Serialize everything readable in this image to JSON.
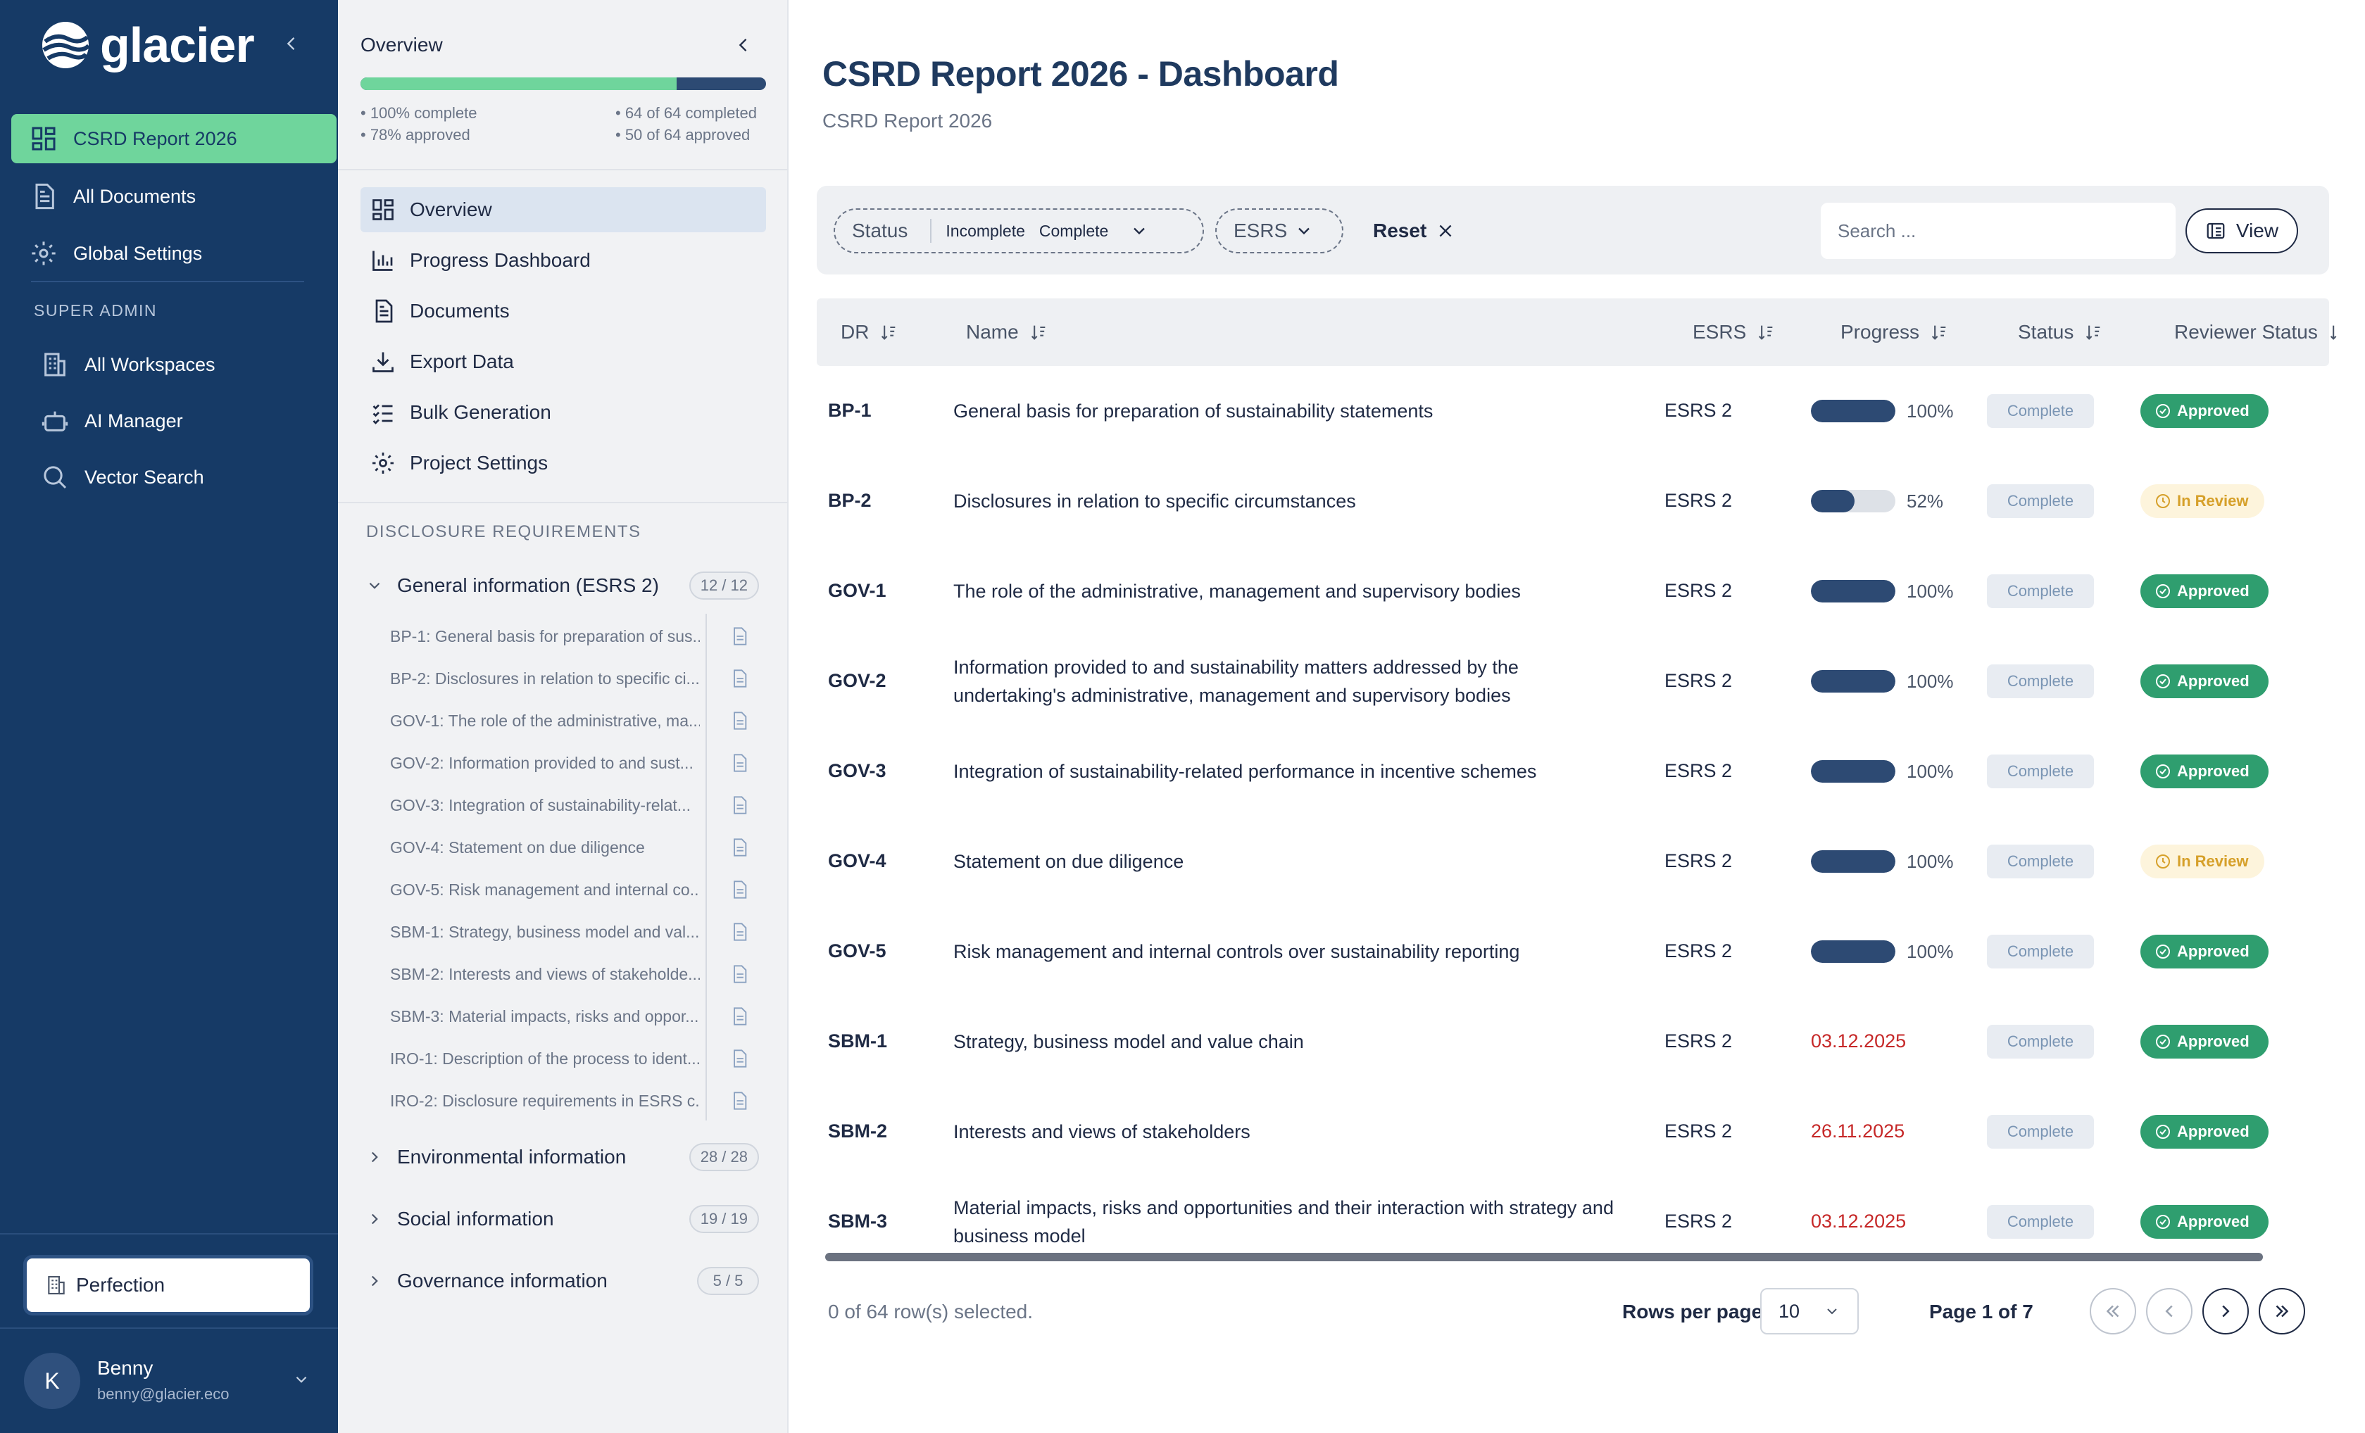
{
  "sidebar": {
    "logo_text": "glacier",
    "nav": [
      {
        "label": "CSRD Report 2026",
        "icon": "dashboard-grid-icon",
        "active": true
      },
      {
        "label": "All Documents",
        "icon": "document-icon"
      },
      {
        "label": "Global Settings",
        "icon": "gear-icon"
      }
    ],
    "section_label": "SUPER ADMIN",
    "admin_nav": [
      {
        "label": "All Workspaces",
        "icon": "building-icon"
      },
      {
        "label": "AI Manager",
        "icon": "robot-icon"
      },
      {
        "label": "Vector Search",
        "icon": "search-icon"
      }
    ],
    "workspace": "Perfection",
    "user": {
      "initial": "K",
      "name": "Benny",
      "email": "benny@glacier.eco"
    }
  },
  "panel": {
    "title": "Overview",
    "progress": {
      "fraction": 0.78,
      "pct_complete": "• 100% complete",
      "pct_approved": "• 78% approved",
      "count_completed": "• 64 of 64 completed",
      "count_approved": "• 50 of 64 approved"
    },
    "menu": [
      {
        "label": "Overview",
        "icon": "dashboard-grid-icon",
        "active": true
      },
      {
        "label": "Progress Dashboard",
        "icon": "bar-chart-icon"
      },
      {
        "label": "Documents",
        "icon": "document-icon"
      },
      {
        "label": "Export Data",
        "icon": "download-icon"
      },
      {
        "label": "Bulk Generation",
        "icon": "checklist-icon"
      },
      {
        "label": "Project Settings",
        "icon": "gear-icon"
      }
    ],
    "section_label": "DISCLOSURE REQUIREMENTS",
    "groups": [
      {
        "label": "General information (ESRS 2)",
        "badge": "12 / 12",
        "expanded": true
      },
      {
        "label": "Environmental information",
        "badge": "28 / 28"
      },
      {
        "label": "Social information",
        "badge": "19 / 19"
      },
      {
        "label": "Governance information",
        "badge": "5 / 5"
      }
    ],
    "docs": [
      "BP-1: General basis for preparation of sus...",
      "BP-2: Disclosures in relation to specific ci...",
      "GOV-1: The role of the administrative, ma...",
      "GOV-2: Information provided to and sust...",
      "GOV-3: Integration of sustainability-relat...",
      "GOV-4: Statement on due diligence",
      "GOV-5: Risk management and internal co...",
      "SBM-1: Strategy, business model and val...",
      "SBM-2: Interests and views of stakeholde...",
      "SBM-3: Material impacts, risks and oppor...",
      "IRO-1: Description of the process to ident...",
      "IRO-2: Disclosure requirements in ESRS c..."
    ]
  },
  "main": {
    "title": "CSRD Report 2026 - Dashboard",
    "subtitle": "CSRD Report 2026",
    "filters": {
      "status_label": "Status",
      "status_chips": [
        "Incomplete",
        "Complete"
      ],
      "esrs_label": "ESRS",
      "reset_label": "Reset",
      "search_placeholder": "Search ...",
      "view_label": "View"
    },
    "columns": [
      "DR",
      "Name",
      "ESRS",
      "Progress",
      "Status",
      "Reviewer Status"
    ],
    "rows": [
      {
        "dr": "BP-1",
        "name": "General basis for preparation of sustainability statements",
        "esrs": "ESRS 2",
        "progress": 100,
        "progress_text": "100%",
        "status": "Complete",
        "review": "Approved"
      },
      {
        "dr": "BP-2",
        "name": "Disclosures in relation to specific circumstances",
        "esrs": "ESRS 2",
        "progress": 52,
        "progress_text": "52%",
        "status": "Complete",
        "review": "In Review"
      },
      {
        "dr": "GOV-1",
        "name": "The role of the administrative, management and supervisory bodies",
        "esrs": "ESRS 2",
        "progress": 100,
        "progress_text": "100%",
        "status": "Complete",
        "review": "Approved"
      },
      {
        "dr": "GOV-2",
        "name": "Information provided to and sustainability matters addressed by the undertaking's administrative, management and supervisory bodies",
        "esrs": "ESRS 2",
        "progress": 100,
        "progress_text": "100%",
        "status": "Complete",
        "review": "Approved"
      },
      {
        "dr": "GOV-3",
        "name": "Integration of sustainability-related performance in incentive schemes",
        "esrs": "ESRS 2",
        "progress": 100,
        "progress_text": "100%",
        "status": "Complete",
        "review": "Approved"
      },
      {
        "dr": "GOV-4",
        "name": "Statement on due diligence",
        "esrs": "ESRS 2",
        "progress": 100,
        "progress_text": "100%",
        "status": "Complete",
        "review": "In Review"
      },
      {
        "dr": "GOV-5",
        "name": "Risk management and internal controls over sustainability reporting",
        "esrs": "ESRS 2",
        "progress": 100,
        "progress_text": "100%",
        "status": "Complete",
        "review": "Approved"
      },
      {
        "dr": "SBM-1",
        "name": "Strategy, business model and value chain",
        "esrs": "ESRS 2",
        "date": "03.12.2025",
        "status": "Complete",
        "review": "Approved"
      },
      {
        "dr": "SBM-2",
        "name": "Interests and views of stakeholders",
        "esrs": "ESRS 2",
        "date": "26.11.2025",
        "status": "Complete",
        "review": "Approved"
      },
      {
        "dr": "SBM-3",
        "name": "Material impacts, risks and opportunities and their interaction with strategy and business model",
        "esrs": "ESRS 2",
        "date": "03.12.2025",
        "status": "Complete",
        "review": "Approved"
      }
    ],
    "footer": {
      "selected": "0 of 64 row(s) selected.",
      "rows_per_page_label": "Rows per page",
      "rows_per_page": "10",
      "page": "Page 1 of 7"
    }
  },
  "colors": {
    "sidebar_bg": "#163a66",
    "accent_green": "#6fd59c",
    "approved": "#2f9e6f",
    "in_review": "#d6a02a",
    "date_red": "#c62828"
  }
}
